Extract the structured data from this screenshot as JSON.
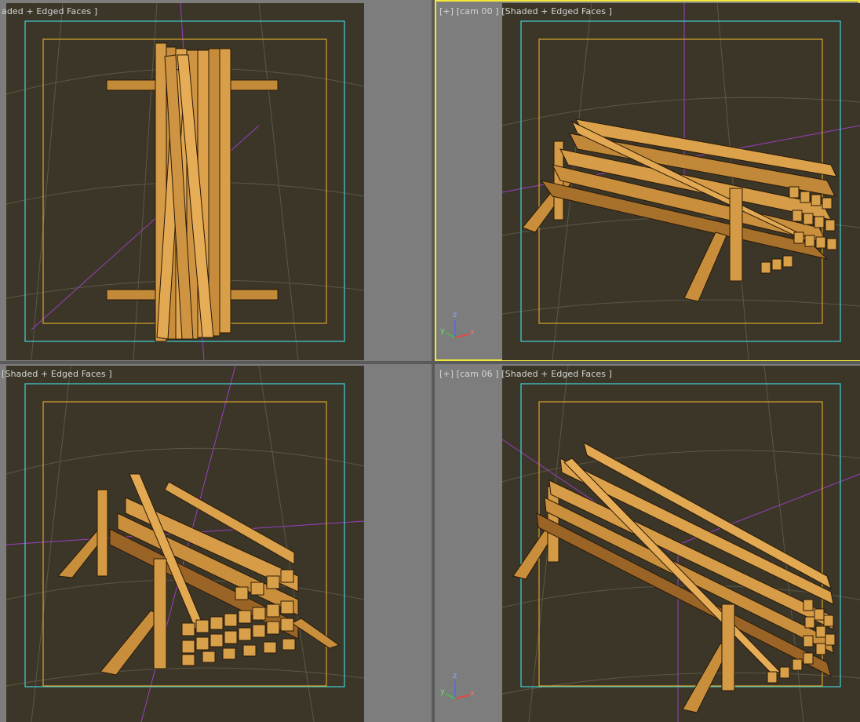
{
  "viewports": {
    "top_left": {
      "label": "aded + Edged Faces ]"
    },
    "top_right": {
      "label": "[+] [cam 00 ] [Shaded + Edged Faces ]"
    },
    "bottom_left": {
      "label": "[Shaded + Edged Faces ]"
    },
    "bottom_right": {
      "label": "[+] [cam 06 ] [Shaded + Edged Faces ]"
    }
  },
  "axis_gizmo": {
    "x": "x",
    "y": "y",
    "z": "z"
  },
  "colors": {
    "scene_bg": "#3b3628",
    "safe_frame_outer": "#3fd3d9",
    "safe_frame_inner": "#d7a52a",
    "wood_light": "#d49a45",
    "wood_dark": "#6e4a1c",
    "active_border": "#f2e83a",
    "gizmo": "#b02ad0"
  }
}
